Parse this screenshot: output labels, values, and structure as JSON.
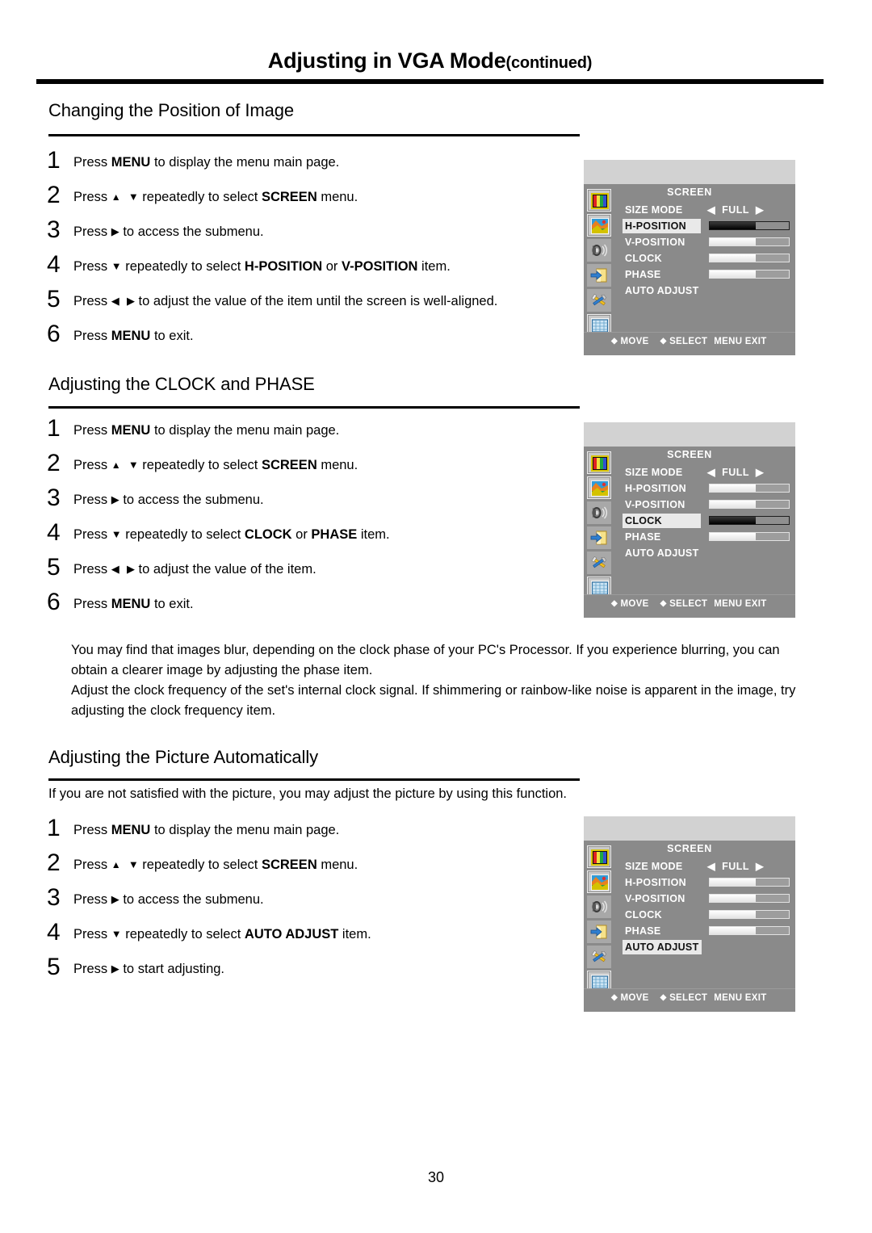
{
  "header": {
    "title": "Adjusting in VGA Mode",
    "continued": "(continued)"
  },
  "footer": {
    "page_number": "30"
  },
  "sections": [
    {
      "heading": "Changing the Position of Image",
      "steps": [
        {
          "num": "1",
          "pre": "Press ",
          "bold1": "MENU",
          "mid": " to display the menu main page.",
          "arrows": ""
        },
        {
          "num": "2",
          "pre": "Press ",
          "arrows": "updown",
          "mid1": " repeatedly to select ",
          "bold1": "SCREEN",
          "mid": " menu."
        },
        {
          "num": "3",
          "pre": "Press ",
          "arrows": "right",
          "mid": " to access the submenu."
        },
        {
          "num": "4",
          "pre": "Press ",
          "arrows": "down",
          "mid1": " repeatedly  to select ",
          "bold1": "H-POSITION",
          "mid2": " or ",
          "bold2": "V-POSITION",
          "mid": " item."
        },
        {
          "num": "5",
          "pre": "Press ",
          "arrows": "leftright",
          "mid": " to adjust the value of the item until the screen is well-aligned."
        },
        {
          "num": "6",
          "pre": "Press ",
          "bold1": "MENU",
          "mid": " to exit.",
          "arrows": ""
        }
      ]
    },
    {
      "heading": "Adjusting the CLOCK and PHASE",
      "steps": [
        {
          "num": "1",
          "pre": "Press ",
          "bold1": "MENU",
          "mid": " to display the menu main page.",
          "arrows": ""
        },
        {
          "num": "2",
          "pre": "Press ",
          "arrows": "updown",
          "mid1": " repeatedly to select ",
          "bold1": "SCREEN",
          "mid": " menu."
        },
        {
          "num": "3",
          "pre": "Press ",
          "arrows": "right",
          "mid": " to access the submenu."
        },
        {
          "num": "4",
          "pre": "Press ",
          "arrows": "down",
          "mid1": " repeatedly to select ",
          "bold1": "CLOCK",
          "mid2": " or ",
          "bold2": "PHASE",
          "mid": " item."
        },
        {
          "num": "5",
          "pre": "Press ",
          "arrows": "leftright",
          "mid": " to adjust the value of the item."
        },
        {
          "num": "6",
          "pre": "Press ",
          "bold1": "MENU",
          "mid": " to exit.",
          "arrows": ""
        }
      ],
      "notes": [
        "You may find that images blur, depending on the clock phase of your PC's Processor. If you experience blurring, you can obtain a clearer image by adjusting the phase item.",
        "Adjust the clock frequency of the set's internal clock signal. If shimmering or rainbow-like noise is apparent in the image, try adjusting the clock frequency item."
      ]
    },
    {
      "heading": "Adjusting the Picture Automatically",
      "intro": "If you are not satisfied with the picture, you may adjust the picture by using this function.",
      "steps": [
        {
          "num": "1",
          "pre": "Press ",
          "bold1": "MENU",
          "mid": " to display the menu main page.",
          "arrows": ""
        },
        {
          "num": "2",
          "pre": "Press ",
          "arrows": "updown",
          "mid1": " repeatedly to select ",
          "bold1": "SCREEN",
          "mid": " menu."
        },
        {
          "num": "3",
          "pre": "Press ",
          "arrows": "right",
          "mid": " to access the submenu."
        },
        {
          "num": "4",
          "pre": "Press ",
          "arrows": "down",
          "mid1": " repeatedly to select ",
          "bold1": "AUTO ADJUST",
          "mid": " item."
        },
        {
          "num": "5",
          "pre": "Press ",
          "arrows": "right",
          "mid": " to start adjusting."
        }
      ]
    }
  ],
  "osd_common": {
    "title": "SCREEN",
    "footer": {
      "move": "MOVE",
      "select": "SELECT",
      "menu_exit": "MENU EXIT",
      "diamond": "◆"
    },
    "rail_icons": [
      "picture-colorbars-icon",
      "image-photo-icon",
      "speaker-sound-icon",
      "input-source-icon",
      "tools-setup-icon",
      "screen-grid-icon"
    ],
    "size_mode_left_arrow": "◀",
    "size_mode_right_arrow": "▶"
  },
  "osd_menus": [
    {
      "name": "osd-h-position",
      "selected": "H-POSITION",
      "rows": [
        {
          "label": "SIZE MODE",
          "type": "value",
          "value": "FULL"
        },
        {
          "label": "H-POSITION",
          "type": "bar",
          "fill": 58
        },
        {
          "label": "V-POSITION",
          "type": "bar",
          "fill": 58
        },
        {
          "label": "CLOCK",
          "type": "bar",
          "fill": 58
        },
        {
          "label": "PHASE",
          "type": "bar",
          "fill": 58
        },
        {
          "label": "AUTO ADJUST",
          "type": "none"
        }
      ]
    },
    {
      "name": "osd-clock",
      "selected": "CLOCK",
      "rows": [
        {
          "label": "SIZE MODE",
          "type": "value",
          "value": "FULL"
        },
        {
          "label": "H-POSITION",
          "type": "bar",
          "fill": 58
        },
        {
          "label": "V-POSITION",
          "type": "bar",
          "fill": 58
        },
        {
          "label": "CLOCK",
          "type": "bar",
          "fill": 58
        },
        {
          "label": "PHASE",
          "type": "bar",
          "fill": 58
        },
        {
          "label": "AUTO ADJUST",
          "type": "none"
        }
      ]
    },
    {
      "name": "osd-auto-adjust",
      "selected": "AUTO ADJUST",
      "rows": [
        {
          "label": "SIZE MODE",
          "type": "value",
          "value": "FULL"
        },
        {
          "label": "H-POSITION",
          "type": "bar",
          "fill": 58
        },
        {
          "label": "V-POSITION",
          "type": "bar",
          "fill": 58
        },
        {
          "label": "CLOCK",
          "type": "bar",
          "fill": 58
        },
        {
          "label": "PHASE",
          "type": "bar",
          "fill": 58
        },
        {
          "label": "AUTO ADJUST",
          "type": "none"
        }
      ]
    }
  ]
}
